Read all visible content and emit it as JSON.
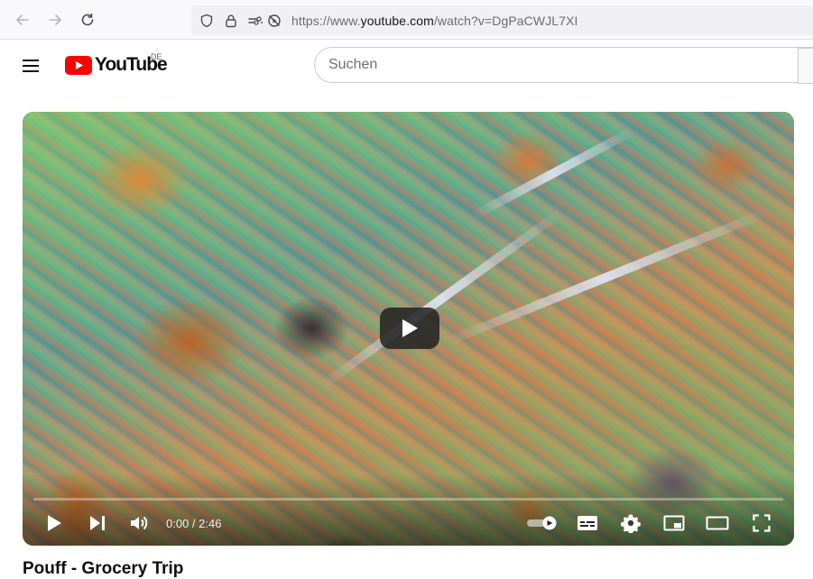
{
  "browser": {
    "url_prefix": "https://www.",
    "url_host": "youtube.com",
    "url_path": "/watch?v=DgPaCWJL7XI",
    "icons": [
      "back-arrow-icon",
      "forward-arrow-icon",
      "reload-icon",
      "shield-icon",
      "lock-icon",
      "permissions-icon",
      "autoplay-blocked-icon"
    ]
  },
  "header": {
    "logo_text": "YouTube",
    "country_code": "DE",
    "search_placeholder": "Suchen"
  },
  "player": {
    "time_current": "0:00",
    "time_separator": " / ",
    "time_total": "2:46",
    "progress_fraction": 0,
    "accent_color": "#ff0000",
    "controls": [
      "play-icon",
      "next-icon",
      "volume-icon",
      "autoplay-toggle",
      "subtitles-icon",
      "settings-gear-icon",
      "miniplayer-icon",
      "theater-mode-icon",
      "fullscreen-icon"
    ]
  },
  "video": {
    "title": "Pouff - Grocery Trip"
  }
}
